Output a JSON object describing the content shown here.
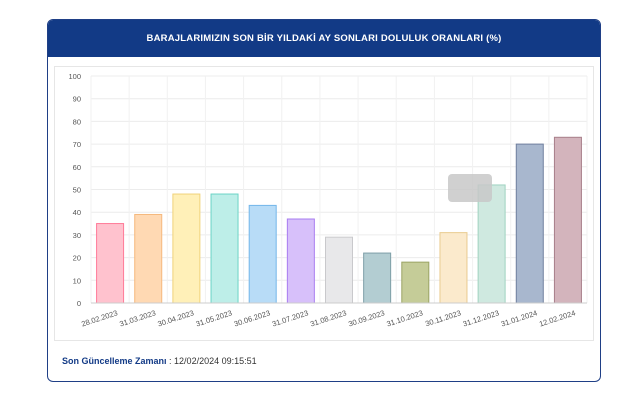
{
  "panel": {
    "title": "BARAJLARIMIZIN SON BİR YILDAKİ AY SONLARI DOLULUK ORANLARI (%)"
  },
  "chart_data": {
    "type": "bar",
    "categories": [
      "28.02.2023",
      "31.03.2023",
      "30.04.2023",
      "31.05.2023",
      "30.06.2023",
      "31.07.2023",
      "31.08.2023",
      "30.09.2023",
      "31.10.2023",
      "30.11.2023",
      "31.12.2023",
      "31.01.2024",
      "12.02.2024"
    ],
    "values": [
      35,
      39,
      48,
      48,
      43,
      37,
      29,
      22,
      18,
      31,
      52,
      70,
      73
    ],
    "ylim": [
      0,
      100
    ],
    "yticks": [
      0,
      10,
      20,
      30,
      40,
      50,
      60,
      70,
      80,
      90,
      100
    ],
    "grid": true,
    "legend": "none",
    "colors": [
      "#ffc2ce",
      "#ffd9b3",
      "#fff0b8",
      "#bdeee8",
      "#b8dcf7",
      "#d7c0fa",
      "#e8e8ea",
      "#b3cdd2",
      "#c5cc98",
      "#fbeacc",
      "#cfe9e0",
      "#a8b7ce",
      "#d3b4bc"
    ],
    "borders": [
      "#ff7a98",
      "#f5b87d",
      "#f0d27a",
      "#6cd3c6",
      "#73b6ea",
      "#a87cf0",
      "#c9c9cc",
      "#7d9ea6",
      "#9aa363",
      "#e9cb8f",
      "#9fd2c0",
      "#6f7f9e",
      "#a87f8a"
    ]
  },
  "footer": {
    "label": "Son Güncelleme Zamanı",
    "separator": " : ",
    "value": "12/02/2024 09:15:51"
  }
}
